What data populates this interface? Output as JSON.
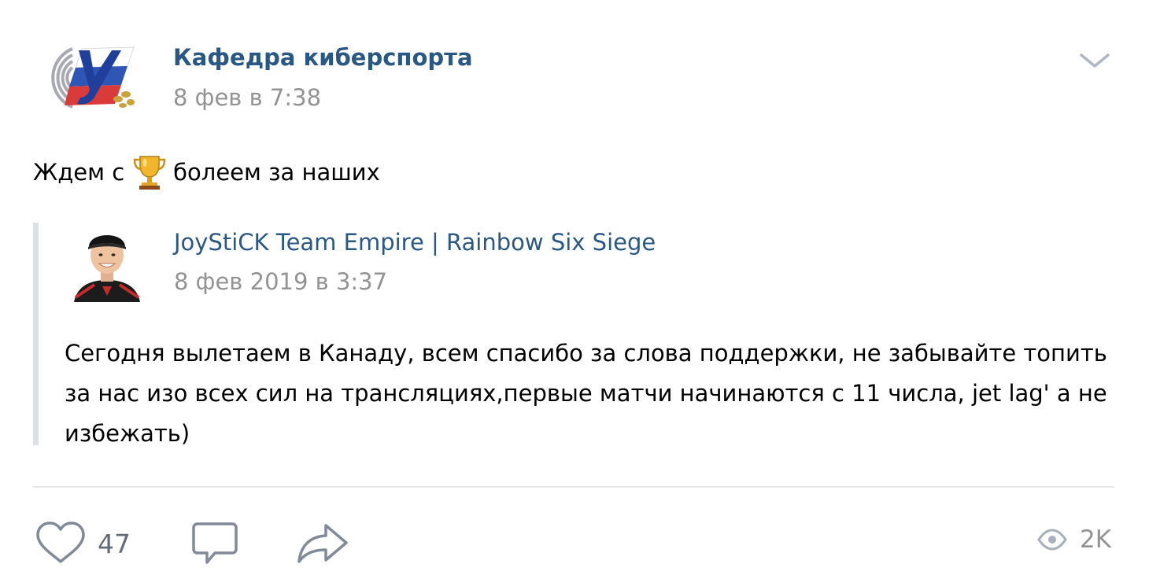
{
  "post": {
    "author": "Кафедра киберспорта",
    "date": "8 фев в 7:38",
    "text_before": "Ждем с",
    "text_after": "болеем за наших",
    "emoji_icon": "trophy-icon"
  },
  "repost": {
    "author": "JoyStiCK Team Empire | Rainbow Six Siege",
    "date": "8 фев 2019 в 3:37",
    "text": "Сегодня вылетаем в Канаду, всем спасибо за слова поддержки, не забывайте топить за нас изо всех сил на трансляциях,первые матчи начинаются с 11 числа, jet lag' а не избежать)"
  },
  "actions": {
    "likes": "47",
    "views": "2K",
    "like_icon": "heart-icon",
    "comment_icon": "comment-icon",
    "share_icon": "share-arrow-icon",
    "views_icon": "eye-icon"
  },
  "colors": {
    "link": "#2a5885",
    "muted": "#939393",
    "action_gray": "#626d7a",
    "divider": "#e7e8ec",
    "quote_bar": "#dce1e6"
  }
}
